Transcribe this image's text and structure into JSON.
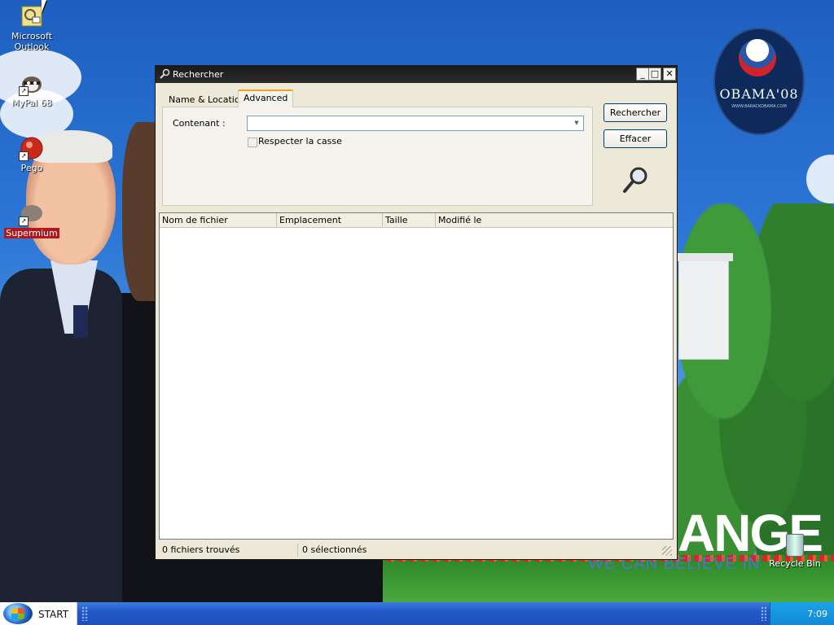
{
  "desktop": {
    "icons": [
      {
        "label": "Microsoft Outlook"
      },
      {
        "label": "MyPal 68"
      },
      {
        "label": "Pego"
      },
      {
        "label": "Supermium"
      }
    ],
    "recycle_bin": "Recycle Bin",
    "wallpaper": {
      "logo_text": "OBAMA'08",
      "logo_url": "WWW.BARACKOBAMA.COM",
      "slogan_big": "ANGE",
      "slogan_small": "WE CAN BELIEVE IN"
    }
  },
  "window": {
    "title": "Rechercher",
    "tabs": [
      {
        "label": "Name & Location"
      },
      {
        "label": "Advanced",
        "active": true
      }
    ],
    "containing_label": "Contenant :",
    "containing_value": "",
    "match_case_label": "Respecter la casse",
    "match_case_checked": false,
    "buttons": {
      "search": "Rechercher",
      "clear": "Effacer"
    },
    "columns": [
      "Nom de fichier",
      "Emplacement",
      "Taille",
      "Modifié le"
    ],
    "rows": [],
    "status": {
      "found": "0 fichiers trouvés",
      "selected": "0 sélectionnés"
    }
  },
  "taskbar": {
    "start_label": "START",
    "clock": "7:09"
  },
  "colors": {
    "titlebar": "#1a1a1a",
    "tab_accent": "#f3a313",
    "button_border": "#003c74",
    "taskbar": "#2259c8",
    "tray": "#1289d6"
  }
}
